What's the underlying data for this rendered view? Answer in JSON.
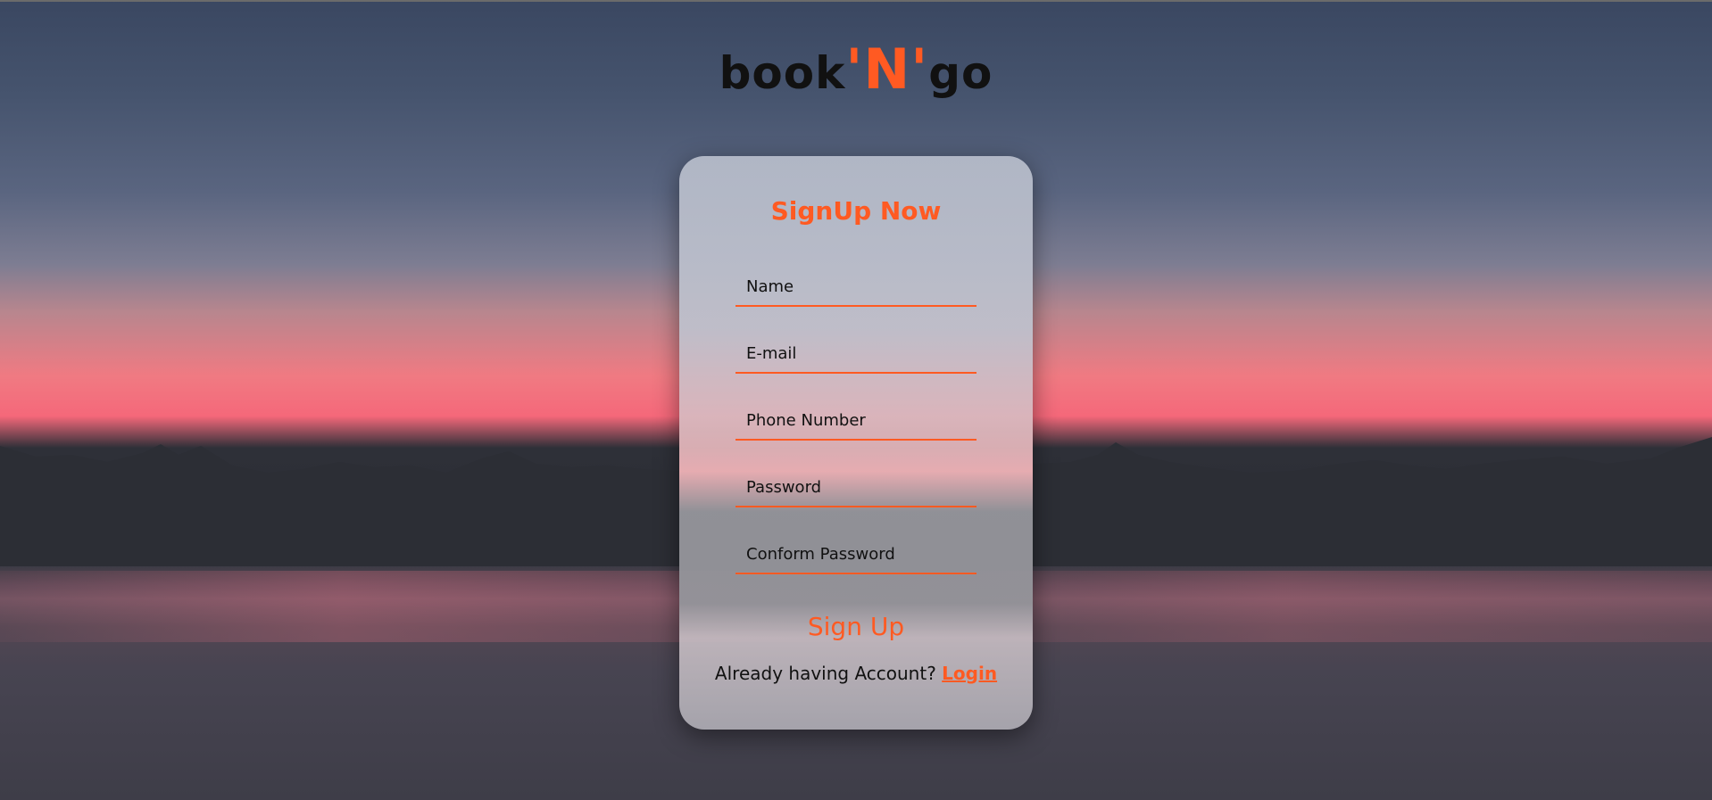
{
  "brand": {
    "part1": "book",
    "accent": "'N'",
    "part2": "go"
  },
  "signup": {
    "title": "SignUp Now",
    "fields": [
      {
        "placeholder": "Name"
      },
      {
        "placeholder": "E-mail"
      },
      {
        "placeholder": "Phone Number"
      },
      {
        "placeholder": "Password"
      },
      {
        "placeholder": "Conform Password"
      }
    ],
    "submit_label": "Sign Up",
    "footer_text": "Already having Account? ",
    "login_link": "Login"
  },
  "colors": {
    "accent": "#ff5a22",
    "text": "#111111"
  }
}
